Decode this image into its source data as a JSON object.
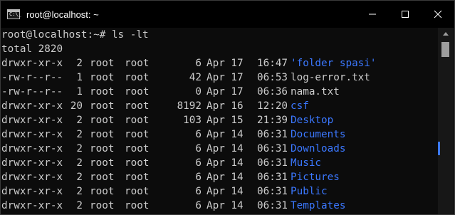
{
  "window": {
    "title": "root@localhost: ~",
    "icon_text": "C:\\_"
  },
  "controls": [
    "minimize-icon",
    "maximize-icon",
    "close-icon"
  ],
  "terminal": {
    "prompt_line": "root@localhost:~# ls -lt",
    "total_line": "total 2820",
    "rows": [
      {
        "perm": "drwxr-xr-x",
        "links": "2",
        "owner": "root",
        "group": "root",
        "size": "6",
        "date": "Apr 17",
        "time": "16:47",
        "name": "'folder spasi'",
        "type": "dir"
      },
      {
        "perm": "-rw-r--r--",
        "links": "1",
        "owner": "root",
        "group": "root",
        "size": "42",
        "date": "Apr 17",
        "time": "06:53",
        "name": "log-error.txt",
        "type": "file"
      },
      {
        "perm": "-rw-r--r--",
        "links": "1",
        "owner": "root",
        "group": "root",
        "size": "0",
        "date": "Apr 17",
        "time": "06:36",
        "name": "nama.txt",
        "type": "file"
      },
      {
        "perm": "drwxr-xr-x",
        "links": "20",
        "owner": "root",
        "group": "root",
        "size": "8192",
        "date": "Apr 16",
        "time": "12:20",
        "name": "csf",
        "type": "dir"
      },
      {
        "perm": "drwxr-xr-x",
        "links": "2",
        "owner": "root",
        "group": "root",
        "size": "103",
        "date": "Apr 15",
        "time": "21:39",
        "name": "Desktop",
        "type": "dir"
      },
      {
        "perm": "drwxr-xr-x",
        "links": "2",
        "owner": "root",
        "group": "root",
        "size": "6",
        "date": "Apr 14",
        "time": "06:31",
        "name": "Documents",
        "type": "dir"
      },
      {
        "perm": "drwxr-xr-x",
        "links": "2",
        "owner": "root",
        "group": "root",
        "size": "6",
        "date": "Apr 14",
        "time": "06:31",
        "name": "Downloads",
        "type": "dir"
      },
      {
        "perm": "drwxr-xr-x",
        "links": "2",
        "owner": "root",
        "group": "root",
        "size": "6",
        "date": "Apr 14",
        "time": "06:31",
        "name": "Music",
        "type": "dir"
      },
      {
        "perm": "drwxr-xr-x",
        "links": "2",
        "owner": "root",
        "group": "root",
        "size": "6",
        "date": "Apr 14",
        "time": "06:31",
        "name": "Pictures",
        "type": "dir"
      },
      {
        "perm": "drwxr-xr-x",
        "links": "2",
        "owner": "root",
        "group": "root",
        "size": "6",
        "date": "Apr 14",
        "time": "06:31",
        "name": "Public",
        "type": "dir"
      },
      {
        "perm": "drwxr-xr-x",
        "links": "2",
        "owner": "root",
        "group": "root",
        "size": "6",
        "date": "Apr 14",
        "time": "06:31",
        "name": "Templates",
        "type": "dir"
      }
    ]
  },
  "colors": {
    "directory": "#3b78ff",
    "text": "#cccccc",
    "background": "#0c0c0c",
    "titlebar": "#000000"
  }
}
